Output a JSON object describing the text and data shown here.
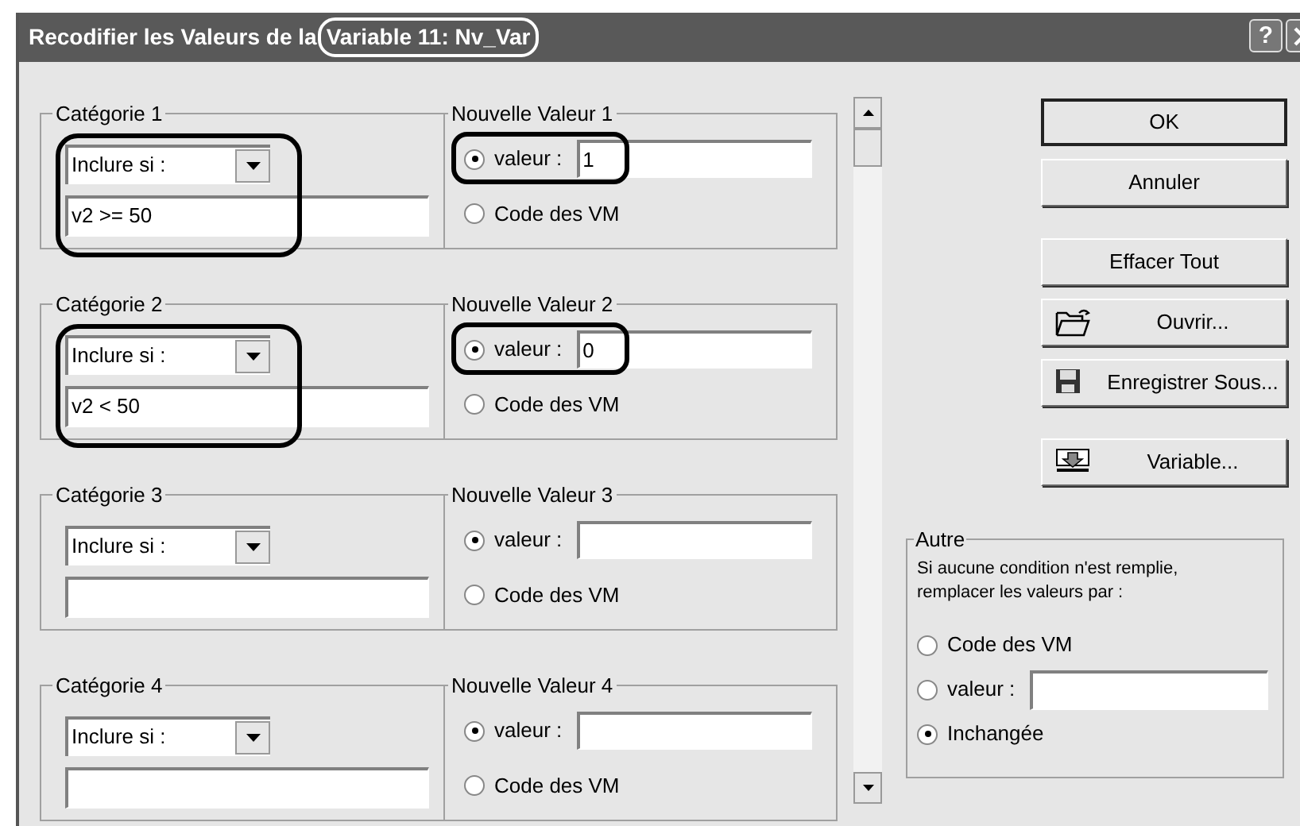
{
  "window": {
    "title": "Recodifier les Valeurs de la",
    "title_variable": "Variable 11: Nv_Var",
    "title_variable_highlighted": true,
    "help_button": "?"
  },
  "categories": [
    {
      "legend": "Catégorie 1",
      "condition_type": "Inclure si :",
      "condition": "v2 >= 50",
      "condition_highlighted": true,
      "value_legend": "Nouvelle Valeur 1",
      "value_highlighted": true,
      "options": [
        {
          "kind": "value",
          "label": "valeur :",
          "selected": true,
          "value": "1"
        },
        {
          "kind": "missing",
          "label": "Code des VM",
          "selected": false
        }
      ]
    },
    {
      "legend": "Catégorie 2",
      "condition_type": "Inclure si :",
      "condition": "v2 < 50",
      "condition_highlighted": true,
      "value_legend": "Nouvelle Valeur 2",
      "value_highlighted": true,
      "options": [
        {
          "kind": "value",
          "label": "valeur :",
          "selected": true,
          "value": "0"
        },
        {
          "kind": "missing",
          "label": "Code des VM",
          "selected": false
        }
      ]
    },
    {
      "legend": "Catégorie 3",
      "condition_type": "Inclure si :",
      "condition_highlighted": false,
      "value_legend": "Nouvelle Valeur 3",
      "value_highlighted": false,
      "options": [
        {
          "kind": "value",
          "label": "valeur :",
          "selected": true
        },
        {
          "kind": "missing",
          "label": "Code des VM",
          "selected": false
        }
      ]
    },
    {
      "legend": "Catégorie 4",
      "condition_type": "Inclure si :",
      "condition_highlighted": false,
      "value_legend": "Nouvelle Valeur 4",
      "value_highlighted": false,
      "options": [
        {
          "kind": "value",
          "label": "valeur :",
          "selected": true
        },
        {
          "kind": "missing",
          "label": "Code des VM",
          "selected": false
        }
      ]
    }
  ],
  "buttons": [
    {
      "label": "OK",
      "kind": "default"
    },
    {
      "label": "Annuler",
      "kind": "plain"
    },
    {
      "label": "Effacer Tout",
      "kind": "plain",
      "gap_before": true
    },
    {
      "label": "Ouvrir...",
      "kind": "open"
    },
    {
      "label": "Enregistrer Sous...",
      "kind": "save"
    },
    {
      "label": "Variable...",
      "kind": "variable",
      "gap_before": true
    }
  ],
  "other": {
    "legend": "Autre",
    "description": "Si aucune condition n'est remplie, remplacer les valeurs par :",
    "options": [
      {
        "kind": "missing",
        "label": "Code des VM",
        "selected": false
      },
      {
        "kind": "value",
        "label": "valeur :",
        "selected": false
      },
      {
        "kind": "unchanged",
        "label": "Inchangée",
        "selected": true
      }
    ]
  }
}
